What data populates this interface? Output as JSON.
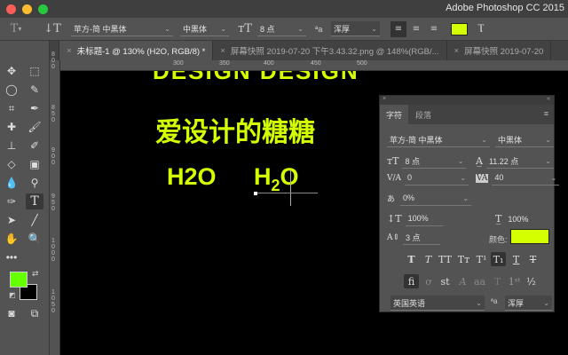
{
  "window": {
    "title": "Adobe Photoshop CC 2015"
  },
  "options": {
    "font_family": "苹方-简 中黑体",
    "font_style": "中黑体",
    "font_size": "8 点",
    "antialias": "浑厚",
    "color": "#d4ff00"
  },
  "tabs": [
    {
      "label": "未标题-1 @ 130% (H2O, RGB/8) *",
      "active": true
    },
    {
      "label": "屏幕快照 2019-07-20 下午3.43.32.png @ 148%(RGB/..."
    },
    {
      "label": "屏幕快照 2019-07-20"
    }
  ],
  "rulers": {
    "h": [
      "300",
      "350",
      "400",
      "450",
      "500"
    ],
    "v": [
      "800",
      "850",
      "900",
      "950",
      "1000",
      "1050"
    ]
  },
  "canvas": {
    "line1": "DESIGN DESIGN",
    "line2": "爱设计的糖糖",
    "h2o_plain": "H2O",
    "h2o_sub": {
      "h": "H",
      "sub": "2",
      "o": "O"
    }
  },
  "colors": {
    "foreground": "#66ff00",
    "background": "#000000",
    "text": "#d4ff00"
  },
  "panel": {
    "tabs": [
      "字符",
      "段落"
    ],
    "font_family": "苹方-简 中黑体",
    "font_style": "中黑体",
    "size": "8 点",
    "leading": "11.22 点",
    "kerning": "0",
    "tracking": "40",
    "tsume": "0%",
    "vscale": "100%",
    "hscale": "100%",
    "baseline": "3 点",
    "color_label": "颜色:",
    "language": "英国英语",
    "antialias": "浑厚"
  }
}
